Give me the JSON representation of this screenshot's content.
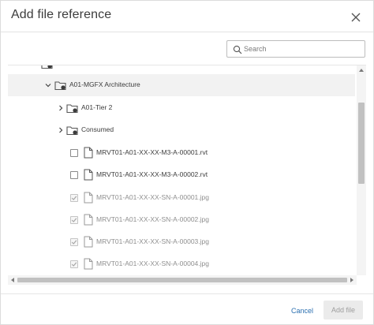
{
  "dialog": {
    "title": "Add file reference",
    "close_icon": "close-icon"
  },
  "search": {
    "placeholder": "Search",
    "value": "",
    "icon": "search-icon"
  },
  "tree": {
    "rows": [
      {
        "label": "A01-MGFX Architecture",
        "type": "folder",
        "expanded": true,
        "selected": true
      },
      {
        "label": "A01-Tier 2",
        "type": "folder",
        "expanded": false
      },
      {
        "label": "Consumed",
        "type": "folder",
        "expanded": false
      },
      {
        "label": "MRVT01-A01-XX-XX-M3-A-00001.rvt",
        "type": "file",
        "checked": false,
        "disabled": false
      },
      {
        "label": "MRVT01-A01-XX-XX-M3-A-00002.rvt",
        "type": "file",
        "checked": false,
        "disabled": false
      },
      {
        "label": "MRVT01-A01-XX-XX-SN-A-00001.jpg",
        "type": "file",
        "checked": true,
        "disabled": true
      },
      {
        "label": "MRVT01-A01-XX-XX-SN-A-00002.jpg",
        "type": "file",
        "checked": true,
        "disabled": true
      },
      {
        "label": "MRVT01-A01-XX-XX-SN-A-00003.jpg",
        "type": "file",
        "checked": true,
        "disabled": true
      },
      {
        "label": "MRVT01-A01-XX-XX-SN-A-00004.jpg",
        "type": "file",
        "checked": true,
        "disabled": true
      }
    ]
  },
  "footer": {
    "cancel_label": "Cancel",
    "add_label": "Add file"
  },
  "colors": {
    "link": "#2a6fb0",
    "selected_row": "#f2f2f2",
    "disabled_button": "#ebebeb"
  }
}
